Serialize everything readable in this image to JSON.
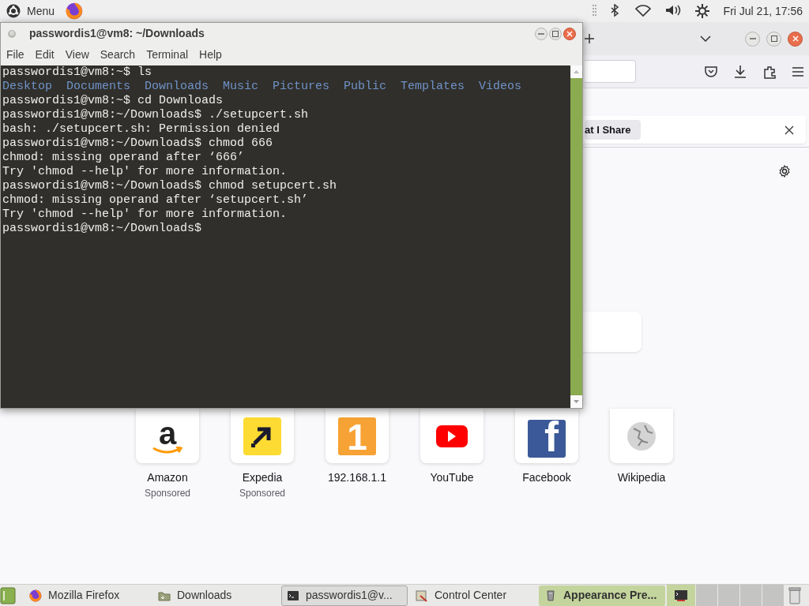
{
  "top_panel": {
    "menu_label": "Menu",
    "clock": "Fri Jul 21, 17:56"
  },
  "terminal": {
    "title": "passwordis1@vm8: ~/Downloads",
    "menu": [
      "File",
      "Edit",
      "View",
      "Search",
      "Terminal",
      "Help"
    ],
    "lines": [
      {
        "kind": "text",
        "text": "passwordis1@vm8:~$ ls"
      },
      {
        "kind": "listing",
        "items": [
          "Desktop",
          "Documents",
          "Downloads",
          "Music",
          "Pictures",
          "Public",
          "Templates",
          "Videos"
        ]
      },
      {
        "kind": "text",
        "text": "passwordis1@vm8:~$ cd Downloads"
      },
      {
        "kind": "text",
        "text": "passwordis1@vm8:~/Downloads$ ./setupcert.sh"
      },
      {
        "kind": "text",
        "text": "bash: ./setupcert.sh: Permission denied"
      },
      {
        "kind": "text",
        "text": "passwordis1@vm8:~/Downloads$ chmod 666"
      },
      {
        "kind": "text",
        "text": "chmod: missing operand after ‘666’"
      },
      {
        "kind": "text",
        "text": "Try 'chmod --help' for more information."
      },
      {
        "kind": "text",
        "text": "passwordis1@vm8:~/Downloads$ chmod setupcert.sh"
      },
      {
        "kind": "text",
        "text": "chmod: missing operand after ‘setupcert.sh’"
      },
      {
        "kind": "text",
        "text": "Try 'chmod --help' for more information."
      },
      {
        "kind": "text",
        "text": "passwordis1@vm8:~/Downloads$"
      }
    ]
  },
  "browser": {
    "notification": {
      "button": "at I Share"
    },
    "top_sites": [
      {
        "name": "Amazon",
        "sponsored": "Sponsored",
        "kind": "smile",
        "glyph": "a"
      },
      {
        "name": "Expedia",
        "sponsored": "Sponsored",
        "kind": "arrow"
      },
      {
        "name": "192.168.1.1",
        "kind": "number",
        "glyph": "1"
      },
      {
        "name": "YouTube",
        "kind": "play"
      },
      {
        "name": "Facebook",
        "kind": "letter",
        "glyph": "f"
      },
      {
        "name": "Wikipedia",
        "kind": "globe"
      }
    ]
  },
  "taskbar": {
    "items": [
      {
        "label": "Mozilla Firefox",
        "kind": "browser",
        "selected": false,
        "highlighted": false
      },
      {
        "label": "Downloads",
        "kind": "folder",
        "selected": false,
        "highlighted": false
      },
      {
        "label": "passwordis1@v...",
        "kind": "terminal",
        "selected": true,
        "highlighted": false
      },
      {
        "label": "Control Center",
        "kind": "control",
        "selected": false,
        "highlighted": false
      },
      {
        "label": "Appearance Pre...",
        "kind": "appearance",
        "selected": false,
        "highlighted": true
      }
    ]
  }
}
